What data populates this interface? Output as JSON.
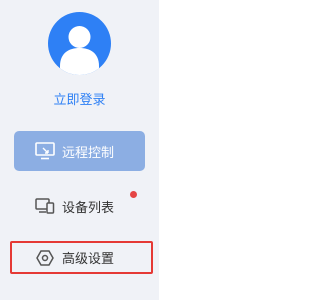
{
  "user": {
    "avatar_icon": "user-avatar-icon",
    "login_label": "立即登录"
  },
  "nav": {
    "items": [
      {
        "label": "远程控制",
        "icon": "remote-desktop-icon",
        "active": true
      },
      {
        "label": "设备列表",
        "icon": "devices-icon",
        "active": false,
        "has_notification": true
      },
      {
        "label": "高级设置",
        "icon": "hexagon-settings-icon",
        "active": false,
        "highlighted": true
      }
    ]
  },
  "colors": {
    "accent": "#2e80f5",
    "active_item_bg": "#8caee3",
    "sidebar_bg": "#f0f2f7",
    "notification_dot": "#e54545",
    "highlight_border": "#e53935"
  }
}
